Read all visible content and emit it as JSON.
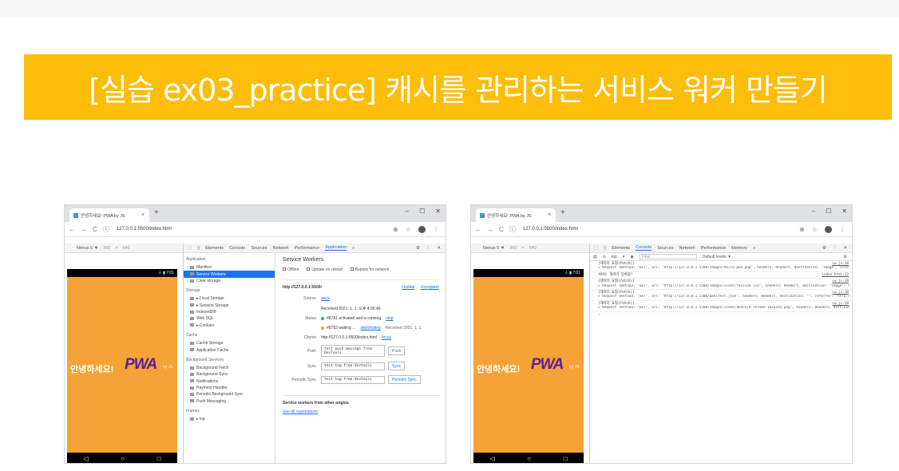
{
  "banner": {
    "title": "[실습 ex03_practice] 캐시를 관리하는 서비스 워커 만들기"
  },
  "browser": {
    "tab_title": "안녕하세요! PWA by JS",
    "url": "127.0.0.1:5500/index.html",
    "device": "Nexus 5 ▼",
    "width": "360",
    "times": "×",
    "height": "640"
  },
  "phone": {
    "status": "⏚ ▮ 7:01",
    "hello": "안녕하세요!",
    "pwa": "PWA",
    "by": "by JS"
  },
  "devtools1": {
    "tabs": [
      "Elements",
      "Console",
      "Sources",
      "Network",
      "Performance",
      "Application",
      "»"
    ],
    "sidebar": {
      "application_h": "Application",
      "application": [
        "Manifest",
        "Service Workers",
        "Clear storage"
      ],
      "storage_h": "Storage",
      "storage": [
        "▸ Local Storage",
        "▸ Session Storage",
        "IndexedDB",
        "Web SQL",
        "▸ Cookies"
      ],
      "cache_h": "Cache",
      "cache": [
        "Cache Storage",
        "Application Cache"
      ],
      "bg_h": "Background Services",
      "bg": [
        "Background Fetch",
        "Background Sync",
        "Notifications",
        "Payment Handler",
        "Periodic Background Sync",
        "Push Messaging"
      ],
      "frames_h": "Frames",
      "frames": [
        "▸ top"
      ]
    },
    "sw": {
      "heading": "Service Workers",
      "opts": [
        "Offline",
        "Update on reload",
        "Bypass for network"
      ],
      "scope_url": "http://127.0.0.1:5500/",
      "update": "Update",
      "unregister": "Unregister",
      "source_k": "Source",
      "source_v": "sw.js",
      "received": "Received 2021. 1. 1. 오후 4:36:49",
      "status_k": "Status",
      "status1": "#8781 activated and is running",
      "stop": "stop",
      "status2": "#8782 waiting ...",
      "skip": "skipWaiting",
      "received2": "Received 2021. 1. 1.",
      "clients_k": "Clients",
      "clients_v": "http://127.0.0.1:5500/index.html",
      "focus": "focus",
      "push_k": "Push",
      "push_v": "test push message from DevTools.",
      "push_btn": "Push",
      "sync_k": "Sync",
      "sync_v": "test-tag-from-devtools",
      "sync_btn": "Sync",
      "psync_k": "Periodic Sync",
      "psync_v": "test-tag-from-devtools",
      "psync_btn": "Periodic Sync",
      "other_h": "Service workers from other origins",
      "see_all": "See all registrations"
    }
  },
  "devtools2": {
    "tabs": [
      "Elements",
      "Console",
      "Sources",
      "Network",
      "Performance",
      "Memory",
      "»"
    ],
    "context": "top",
    "filter": "Filter",
    "levels": "Default levels ▼",
    "logs": [
      {
        "msg": "[데이터 요청(fetch)]",
        "src": "sw.js:18",
        "detail": "▸ Request {method: \"GET\", url: \"http://127.0.0.1:5500/images/hello-pwa.png\", headers: Headers, destination: \"image\", referrer: \"http://127.0.0.1:5500/index.html\", …}"
      },
      {
        "msg": "서비스 워커가 등록됨!",
        "src": "index.html:12",
        "detail": ""
      },
      {
        "msg": "[데이터 요청(fetch)]",
        "src": "sw.js:18",
        "detail": "▸ Request {method: \"GET\", url: \"http://127.0.0.1:5500/images/icons/favicon.ico\", headers: Headers, destination: \"image\", referrer: \"http://127.0.0.1:5500/index.html\", …}"
      },
      {
        "msg": "[데이터 요청(fetch)]",
        "src": "sw.js:18",
        "detail": "▸ Request {method: \"GET\", url: \"http://127.0.0.1:5500/manifest.json\", headers: Headers, destination: \"\", referrer: \"http://127.0.0.1:5500/index.html\", …}"
      },
      {
        "msg": "[데이터 요청(fetch)]",
        "src": "sw.js:18",
        "detail": "▸ Request {method: \"GET\", url: \"http://127.0.0.1:5500/images/icons/android-chrome-192x192.png\", headers: Headers, destination: \"image\", referrer: \"http://127.0.0.1:5500/index.html\", …}"
      }
    ]
  }
}
